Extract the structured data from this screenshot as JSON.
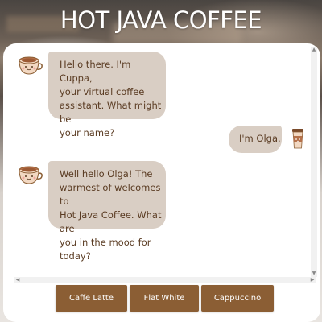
{
  "app": {
    "title": "HOT JAVA COFFEE"
  },
  "colors": {
    "bubble": "#d9cec4",
    "text": "#5a3b22",
    "button": "#8b5e34"
  },
  "messages": [
    {
      "sender": "bot",
      "avatar": "coffee-cup-icon",
      "lines": [
        "Hello there. I'm Cuppa,",
        "your virtual coffee",
        "assistant. What might be",
        "your name?"
      ]
    },
    {
      "sender": "user",
      "avatar": "takeaway-cup-icon",
      "lines": [
        "I'm Olga."
      ]
    },
    {
      "sender": "bot",
      "avatar": "coffee-cup-icon",
      "lines": [
        "Well hello Olga! The",
        "warmest of welcomes to",
        "Hot Java Coffee. What are",
        "you in the mood for today?"
      ]
    }
  ],
  "quick_replies": [
    "Caffe Latte",
    "Flat White",
    "Cappuccino"
  ]
}
